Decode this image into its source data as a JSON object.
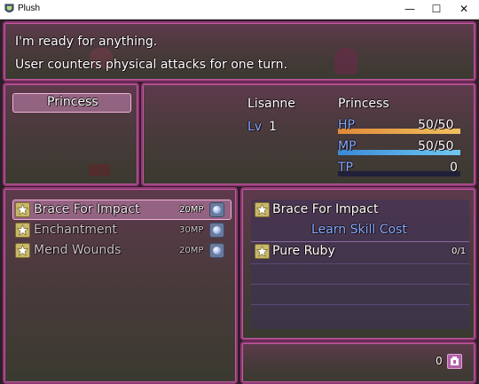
{
  "window": {
    "title": "Plush",
    "min": "—",
    "max": "☐",
    "close": "✕"
  },
  "help": {
    "line1": "I'm ready for anything.",
    "line2": "User counters physical attacks for one turn."
  },
  "category": {
    "selected": "Princess"
  },
  "actor": {
    "name": "Lisanne",
    "class": "Princess",
    "level_label": "Lv",
    "level": "1",
    "hp_label": "HP",
    "hp": "50/50",
    "hp_fraction": 1.0,
    "mp_label": "MP",
    "mp": "50/50",
    "mp_fraction": 1.0,
    "tp_label": "TP",
    "tp": "0",
    "tp_fraction": 0.0
  },
  "skills": [
    {
      "name": "Brace For Impact",
      "cost": "20MP",
      "icon": "star-icon",
      "cost_icon": "orb-icon",
      "selected": true
    },
    {
      "name": "Enchantment",
      "cost": "30MP",
      "icon": "star-icon",
      "cost_icon": "orb-icon",
      "selected": false
    },
    {
      "name": "Mend Wounds",
      "cost": "20MP",
      "icon": "star-icon",
      "cost_icon": "orb-icon",
      "selected": false
    }
  ],
  "learn": {
    "skill_name": "Brace For Impact",
    "header": "Learn Skill Cost",
    "items": [
      {
        "name": "Pure Ruby",
        "count": "0/1",
        "icon": "star-icon"
      }
    ]
  },
  "gold": {
    "value": "0",
    "icon": "bag-icon"
  },
  "colors": {
    "hp_a": "#e08a38",
    "hp_b": "#f0c060",
    "mp_a": "#3a8ad8",
    "mp_b": "#70c8f0",
    "system": "#84aaff",
    "frame": "#8e3a72"
  }
}
